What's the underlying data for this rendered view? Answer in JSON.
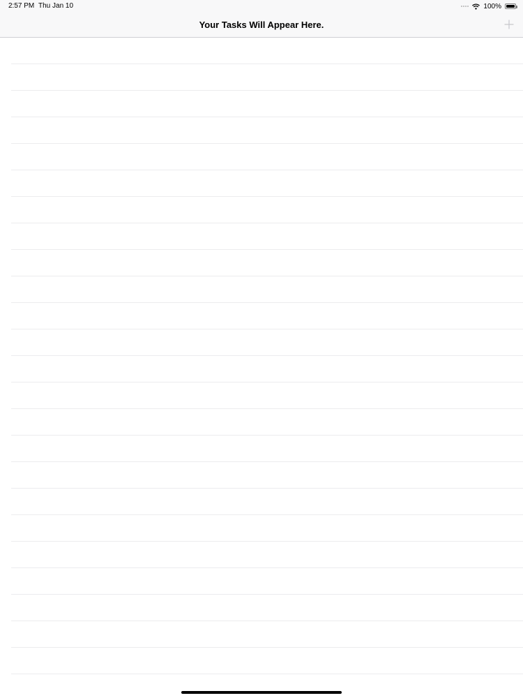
{
  "status_bar": {
    "time": "2:57 PM",
    "date": "Thu Jan 10",
    "battery_percent": "100%",
    "battery_level": 1.0,
    "wifi_icon": "wifi-icon",
    "signal_icon": "cellular-dots-icon"
  },
  "nav_bar": {
    "title": "Your Tasks Will Appear Here.",
    "add_icon": "plus-icon",
    "add_enabled": false
  },
  "table": {
    "row_count": 24
  },
  "colors": {
    "bar_background": "#f8f8f9",
    "separator": "#ececee",
    "disabled_tint": "#c7c7cc"
  }
}
